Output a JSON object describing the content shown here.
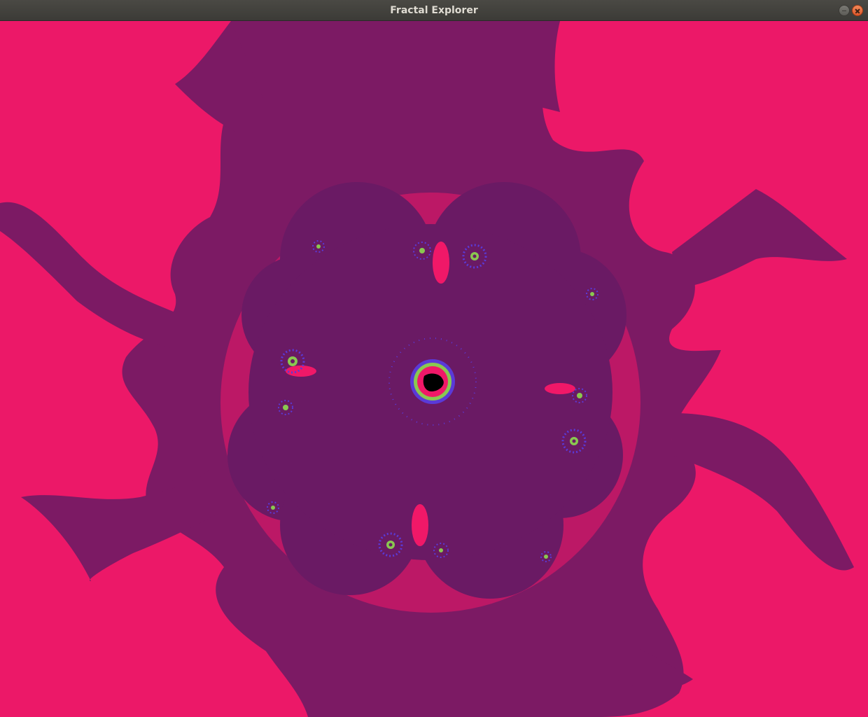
{
  "window": {
    "title": "Fractal Explorer"
  },
  "colors": {
    "background": "#ec1868",
    "outer_band": "#7c1a64",
    "inner_body": "#6a1a64",
    "filament": "#f01868",
    "spiral_blue": "#5a3ad8",
    "spiral_green": "#8ac850",
    "core": "#000000"
  },
  "icons": {
    "minimize": "minimize-icon",
    "close": "close-icon"
  }
}
